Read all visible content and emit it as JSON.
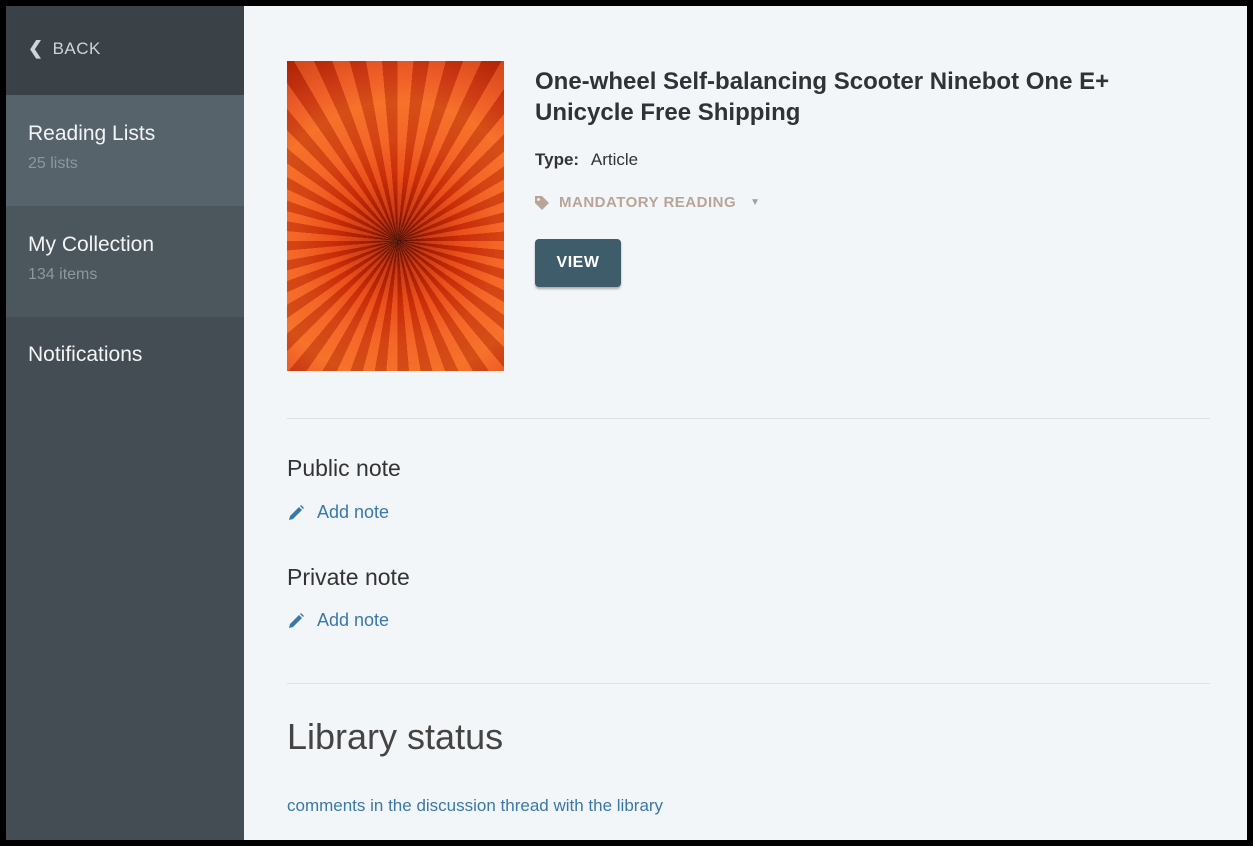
{
  "sidebar": {
    "back_label": "BACK",
    "items": [
      {
        "title": "Reading Lists",
        "sub": "25 lists"
      },
      {
        "title": "My Collection",
        "sub": "134 items"
      },
      {
        "title": "Notifications"
      }
    ]
  },
  "item": {
    "title": "One-wheel Self-balancing Scooter Ninebot One E+ Unicycle Free Shipping",
    "type_label": "Type:",
    "type_value": "Article",
    "tag": "MANDATORY READING",
    "view_label": "VIEW"
  },
  "notes": {
    "public_heading": "Public note",
    "private_heading": "Private note",
    "add_note_label": "Add note"
  },
  "library": {
    "heading": "Library status",
    "link": "comments in the discussion thread with the library"
  },
  "colors": {
    "sidebar_bg": "#454d54",
    "active_item_bg": "#56636a",
    "button_bg": "#3e5c69",
    "link": "#3a78a8",
    "tag": "#b8a597"
  }
}
